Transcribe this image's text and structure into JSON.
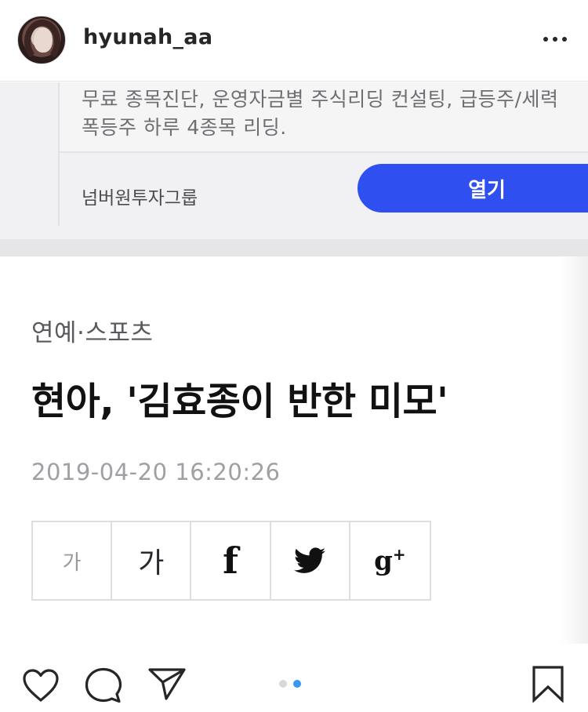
{
  "header": {
    "username": "hyunah_aa",
    "more_icon": "more-horizontal-icon"
  },
  "post_image": {
    "ad": {
      "text_line1": "무료 종목진단, 운영자금별 주식리딩 컨설팅, 급등주/세력",
      "text_line2": "폭등주 하루 4종목 리딩.",
      "sponsor": "넘버원투자그룹",
      "open_button": "열기",
      "button_color": "#2f4ff0"
    },
    "article": {
      "category": "연예·스포츠",
      "headline": "현아, '김효종이 반한 미모'",
      "timestamp": "2019-04-20 16:20:26",
      "share": {
        "font_small": "가",
        "font_large": "가",
        "facebook_glyph": "f",
        "twitter_icon": "twitter-bird-icon",
        "google_plus_glyph": "g",
        "google_plus_sup": "+"
      }
    }
  },
  "actions": {
    "like_icon": "heart-icon",
    "comment_icon": "comment-bubble-icon",
    "share_icon": "paper-plane-icon",
    "save_icon": "bookmark-icon",
    "carousel": {
      "total": 2,
      "active": 2,
      "active_color": "#3897f0",
      "inactive_color": "#d8d8d8"
    }
  }
}
